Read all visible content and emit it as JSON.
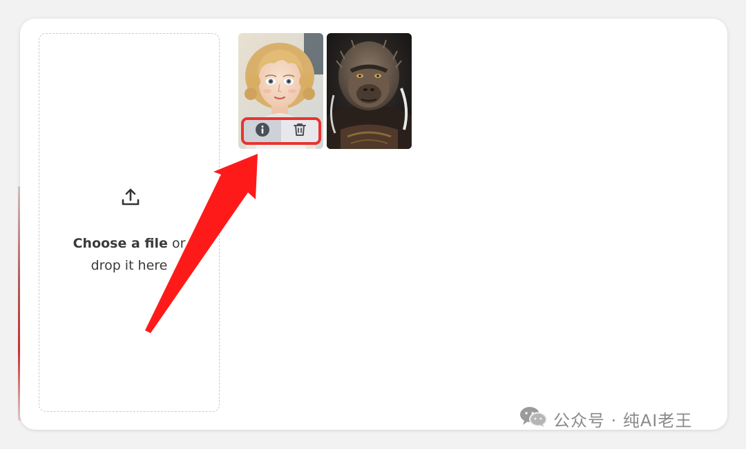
{
  "dropzone": {
    "line1_strong": "Choose a file",
    "line1_rest": " or",
    "line2": "drop it here",
    "icon": "upload-icon"
  },
  "thumbnails": [
    {
      "subject": "watercolor portrait of a curly-haired blonde girl"
    },
    {
      "subject": "dark portrait of a monkey warrior"
    }
  ],
  "thumbnail_actions": {
    "info_icon": "info-icon",
    "delete_icon": "trash-icon",
    "highlight_color": "#e8332e"
  },
  "annotation": {
    "arrow_color": "#ff1a1a"
  },
  "watermark": {
    "text": "公众号 · 纯AI老王",
    "icon": "wechat-icon"
  }
}
